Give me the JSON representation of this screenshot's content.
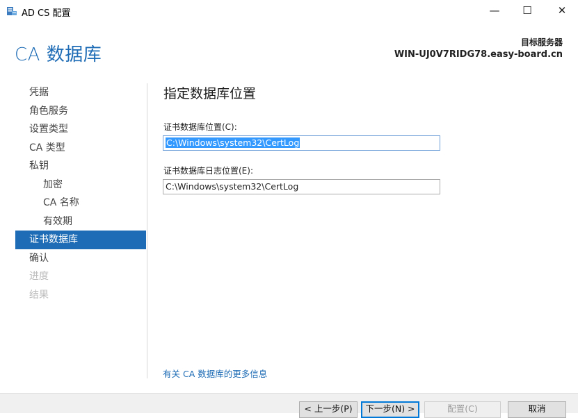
{
  "window": {
    "title": "AD CS 配置",
    "min_glyph": "—",
    "max_glyph": "☐",
    "close_glyph": "✕"
  },
  "header": {
    "page_title": "CA 数据库",
    "server_label": "目标服务器",
    "server_name": "WIN-UJ0V7RIDG78.easy-board.cn"
  },
  "nav": [
    {
      "label": "凭据",
      "state": "normal"
    },
    {
      "label": "角色服务",
      "state": "normal"
    },
    {
      "label": "设置类型",
      "state": "normal"
    },
    {
      "label": "CA 类型",
      "state": "normal"
    },
    {
      "label": "私钥",
      "state": "normal"
    },
    {
      "label": "加密",
      "state": "sub"
    },
    {
      "label": "CA 名称",
      "state": "sub"
    },
    {
      "label": "有效期",
      "state": "sub"
    },
    {
      "label": "证书数据库",
      "state": "active"
    },
    {
      "label": "确认",
      "state": "normal"
    },
    {
      "label": "进度",
      "state": "disabled"
    },
    {
      "label": "结果",
      "state": "disabled"
    }
  ],
  "main": {
    "section_title": "指定数据库位置",
    "db_label": "证书数据库位置(C):",
    "db_value": "C:\\Windows\\system32\\CertLog",
    "log_label": "证书数据库日志位置(E):",
    "log_value": "C:\\Windows\\system32\\CertLog",
    "more_info_link": "有关 CA 数据库的更多信息"
  },
  "footer": {
    "prev_label": "< 上一步(P)",
    "next_label": "下一步(N) >",
    "config_label": "配置(C)",
    "cancel_label": "取消"
  },
  "colors": {
    "accent": "#1e6cb5",
    "selection": "#3399ff",
    "disabled_text": "#bcbcbc"
  },
  "icons": {
    "app": "server-config-icon"
  }
}
